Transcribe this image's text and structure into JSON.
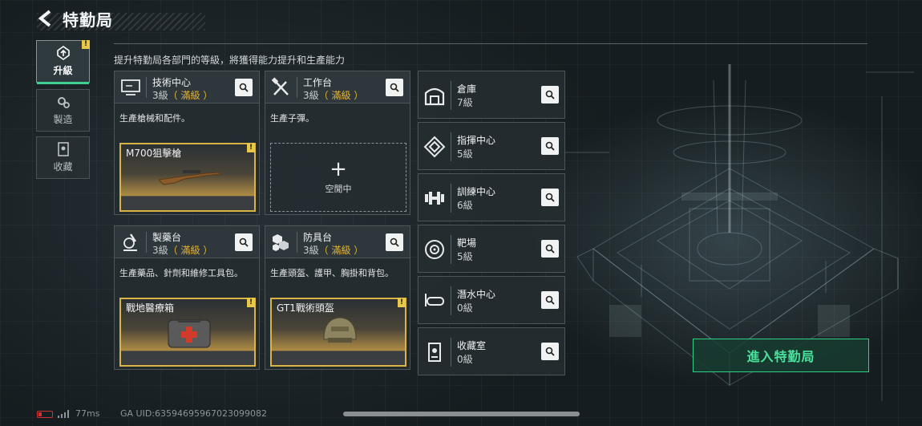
{
  "header": {
    "title": "特勤局"
  },
  "tabs": [
    {
      "label": "升級",
      "active": true,
      "badge": "!"
    },
    {
      "label": "製造",
      "active": false
    },
    {
      "label": "收藏",
      "active": false
    }
  ],
  "subtitle": "提升特勤局各部門的等級，將獲得能力提升和生產能力",
  "cards": [
    {
      "name": "技術中心",
      "level": "3級",
      "maxed": "（ 滿級 ）",
      "desc": "生產槍械和配件。",
      "slot": {
        "type": "item",
        "item": "M700狙擊槍",
        "badge": "!"
      }
    },
    {
      "name": "工作台",
      "level": "3級",
      "maxed": "（ 滿級 ）",
      "desc": "生產子彈。",
      "slot": {
        "type": "empty",
        "plus": "+",
        "idle": "空閒中"
      }
    },
    {
      "name": "製藥台",
      "level": "3級",
      "maxed": "（ 滿級 ）",
      "desc": "生產藥品、針劑和維修工具包。",
      "slot": {
        "type": "item",
        "item": "戰地醫療箱",
        "badge": "!"
      }
    },
    {
      "name": "防具台",
      "level": "3級",
      "maxed": "（ 滿級 ）",
      "desc": "生產頭盔、護甲、胸掛和背包。",
      "slot": {
        "type": "item",
        "item": "GT1戰術頭盔",
        "badge": "!"
      }
    }
  ],
  "facilities": [
    {
      "name": "倉庫",
      "level": "7級",
      "icon": "warehouse-icon"
    },
    {
      "name": "指揮中心",
      "level": "5級",
      "icon": "command-icon"
    },
    {
      "name": "訓練中心",
      "level": "6級",
      "icon": "dumbbell-icon"
    },
    {
      "name": "靶場",
      "level": "5級",
      "icon": "target-icon"
    },
    {
      "name": "潛水中心",
      "level": "0級",
      "icon": "diving-mask-icon"
    },
    {
      "name": "收藏室",
      "level": "0級",
      "icon": "collection-icon"
    }
  ],
  "enter_button": "進入特勤局",
  "status": {
    "ping": "77ms",
    "uid": "GA UID:635946959670230​99082"
  },
  "colors": {
    "accent_green": "#3fcf8e",
    "maxed_gold": "#e5b437",
    "slot_border": "#d9b443"
  }
}
